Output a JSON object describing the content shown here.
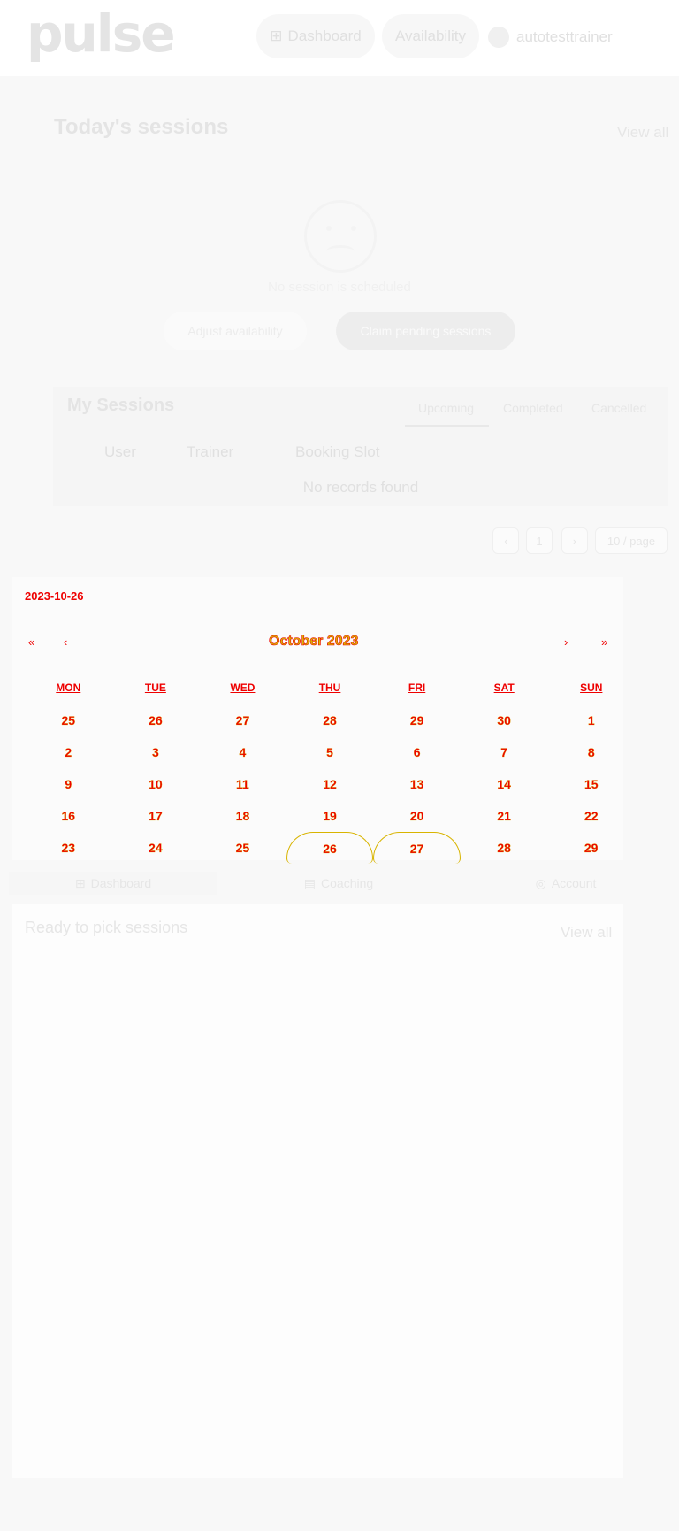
{
  "header": {
    "logo": "pulse",
    "nav": [
      {
        "label": "Dashboard",
        "icon": "grid-icon"
      },
      {
        "label": "Availability"
      }
    ],
    "username": "autotesttrainer"
  },
  "today": {
    "title": "Today's sessions",
    "view_all": "View all",
    "empty_text": "No session is scheduled",
    "adjust_label": "Adjust availability",
    "claim_label": "Claim pending sessions"
  },
  "my_sessions": {
    "title": "My Sessions",
    "tabs": [
      "Upcoming",
      "Completed",
      "Cancelled"
    ],
    "columns": [
      "User",
      "Trainer",
      "Booking Slot"
    ],
    "empty_text": "No records found"
  },
  "pagination": {
    "current_page": "1",
    "page_size": "10 / page"
  },
  "calendar": {
    "selected_date": "2023-10-26",
    "month_label": "October 2023",
    "nav": {
      "prev_year": "«",
      "prev_month": "‹",
      "next_month": "›",
      "next_year": "»"
    },
    "weekdays": [
      "MON",
      "TUE",
      "WED",
      "THU",
      "FRI",
      "SAT",
      "SUN"
    ],
    "weeks": [
      [
        "25",
        "26",
        "27",
        "28",
        "29",
        "30",
        "1"
      ],
      [
        "2",
        "3",
        "4",
        "5",
        "6",
        "7",
        "8"
      ],
      [
        "9",
        "10",
        "11",
        "12",
        "13",
        "14",
        "15"
      ],
      [
        "16",
        "17",
        "18",
        "19",
        "20",
        "21",
        "22"
      ],
      [
        "23",
        "24",
        "25",
        "26",
        "27",
        "28",
        "29"
      ]
    ],
    "highlighted": [
      "26",
      "27"
    ]
  },
  "tabbar": [
    {
      "label": "Dashboard",
      "icon": "grid-icon"
    },
    {
      "label": "Coaching",
      "icon": "card-icon"
    },
    {
      "label": "Account",
      "icon": "user-circle-icon"
    }
  ],
  "ready": {
    "title": "Ready to pick sessions",
    "view_all": "View all"
  }
}
